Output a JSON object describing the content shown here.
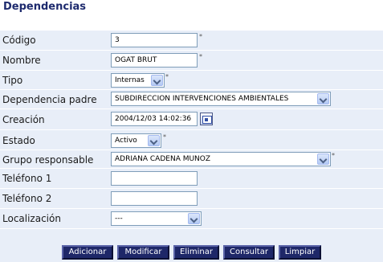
{
  "page": {
    "title": "Dependencias"
  },
  "form": {
    "codigo": {
      "label": "Código",
      "value": "3",
      "required_mark": "*"
    },
    "nombre": {
      "label": "Nombre",
      "value": "OGAT BRUT",
      "required_mark": "*"
    },
    "tipo": {
      "label": "Tipo",
      "value": "Internas",
      "required_mark": "*"
    },
    "dependencia_padre": {
      "label": "Dependencia padre",
      "value": "SUBDIRECCION INTERVENCIONES AMBIENTALES"
    },
    "creacion": {
      "label": "Creación",
      "value": "2004/12/03 14:02:36"
    },
    "estado": {
      "label": "Estado",
      "value": "Activo",
      "required_mark": "*"
    },
    "grupo_responsable": {
      "label": "Grupo responsable",
      "value": "ADRIANA CADENA MUNOZ",
      "required_mark": "*"
    },
    "telefono1": {
      "label": "Teléfono 1",
      "value": ""
    },
    "telefono2": {
      "label": "Teléfono 2",
      "value": ""
    },
    "localizacion": {
      "label": "Localización",
      "value": "---"
    }
  },
  "buttons": {
    "adicionar": "Adicionar",
    "modificar": "Modificar",
    "eliminar": "Eliminar",
    "consultar": "Consultar",
    "limpiar": "Limpiar"
  },
  "colors": {
    "title": "#1e2b6e",
    "form_background": "#e8eef8",
    "button_background": "#1e2768",
    "input_border": "#7f9db9"
  },
  "icons": {
    "calendar": "calendar-icon",
    "dropdown": "chevron-down-icon"
  }
}
